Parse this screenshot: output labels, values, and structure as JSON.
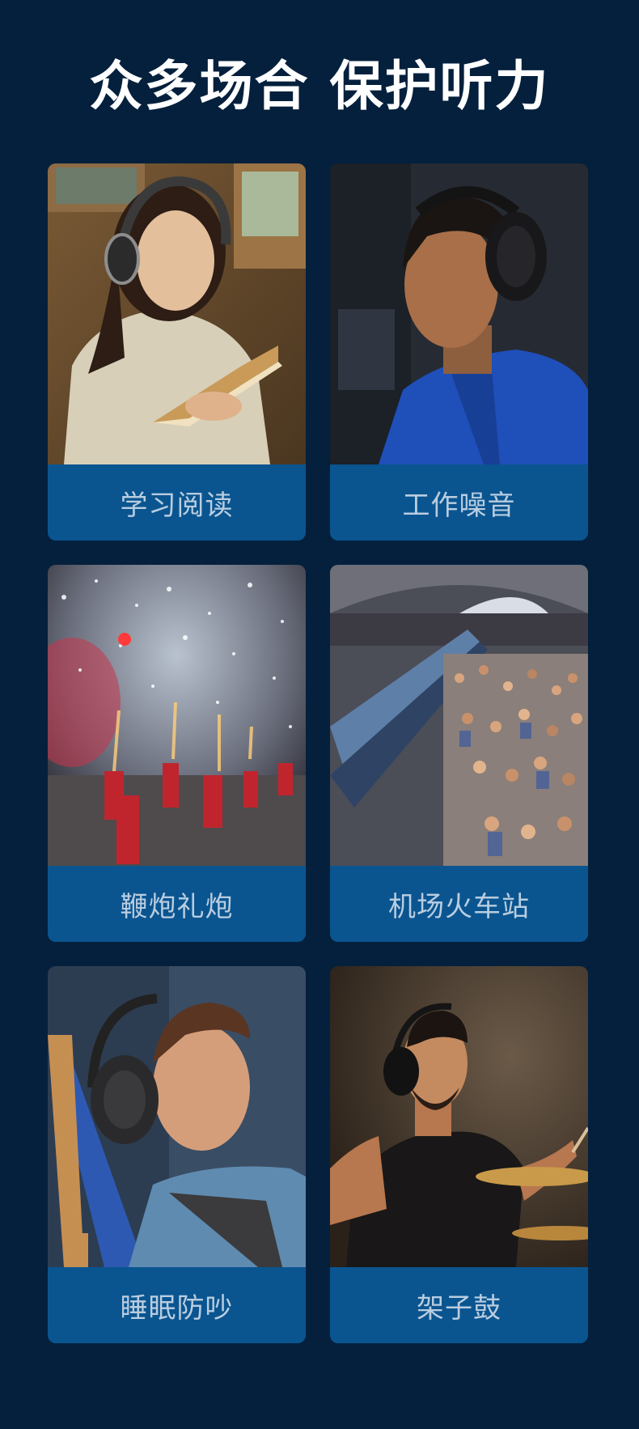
{
  "header": {
    "title": "众多场合 保护听力"
  },
  "scenes": [
    {
      "label": "学习阅读",
      "icon": "girl-reading-with-headphones"
    },
    {
      "label": "工作噪音",
      "icon": "worker-with-ear-muffs"
    },
    {
      "label": "鞭炮礼炮",
      "icon": "firecrackers"
    },
    {
      "label": "机场火车站",
      "icon": "crowded-train-station"
    },
    {
      "label": "睡眠防吵",
      "icon": "man-sleeping-with-headphones"
    },
    {
      "label": "架子鼓",
      "icon": "drummer-with-headphones"
    }
  ],
  "colors": {
    "background": "#04203d",
    "label_background": "#0a5590",
    "label_text": "#b9cde0",
    "title_text": "#ffffff"
  }
}
